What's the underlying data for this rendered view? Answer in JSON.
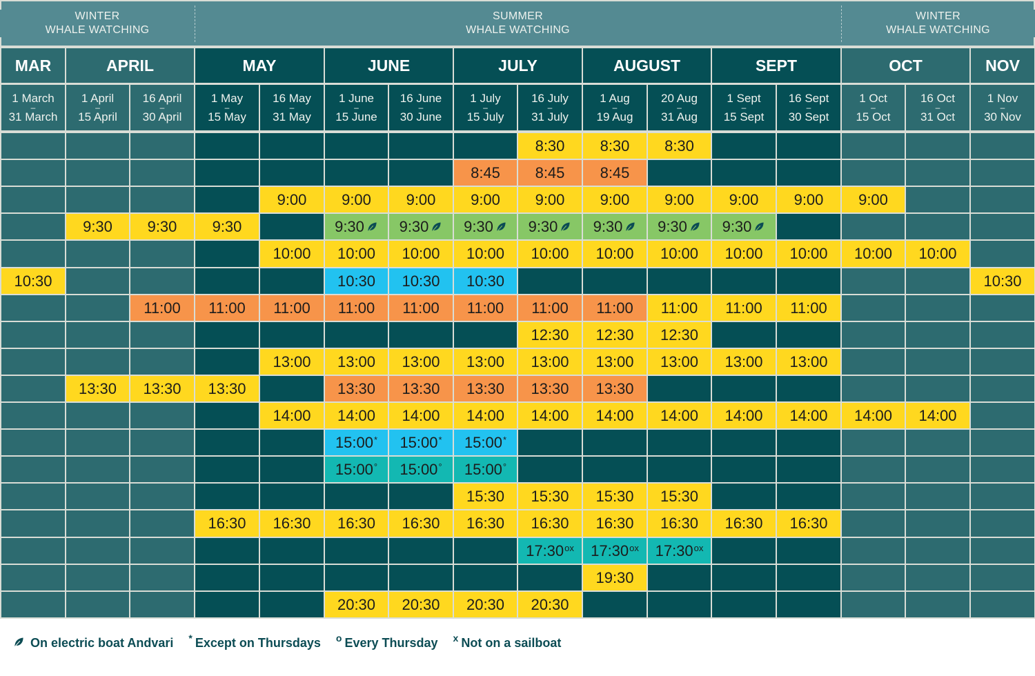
{
  "colors": {
    "season_header": "#548a92",
    "winter_bg": "#2d6b70",
    "summer_bg": "#054f55",
    "yellow": "#ffd81f",
    "orange": "#f7944a",
    "green": "#87c766",
    "blue": "#22c2f0",
    "teal": "#13b8b2",
    "grid_line": "#d9ddd6",
    "legend_text": "#0c4c54",
    "leaf": "#0c4c54"
  },
  "seasons": [
    {
      "line1": "WINTER",
      "line2": "WHALE WATCHING",
      "span": [
        0,
        2
      ]
    },
    {
      "line1": "SUMMER",
      "line2": "WHALE WATCHING",
      "span": [
        3,
        12
      ]
    },
    {
      "line1": "WINTER",
      "line2": "WHALE WATCHING",
      "span": [
        13,
        15
      ]
    }
  ],
  "months": [
    {
      "label": "MAR",
      "span": [
        0,
        0
      ],
      "tone": "light"
    },
    {
      "label": "APRIL",
      "span": [
        1,
        2
      ],
      "tone": "light"
    },
    {
      "label": "MAY",
      "span": [
        3,
        4
      ],
      "tone": "dark"
    },
    {
      "label": "JUNE",
      "span": [
        5,
        6
      ],
      "tone": "dark"
    },
    {
      "label": "JULY",
      "span": [
        7,
        8
      ],
      "tone": "dark"
    },
    {
      "label": "AUGUST",
      "span": [
        9,
        10
      ],
      "tone": "dark"
    },
    {
      "label": "SEPT",
      "span": [
        11,
        12
      ],
      "tone": "dark"
    },
    {
      "label": "OCT",
      "span": [
        13,
        14
      ],
      "tone": "light"
    },
    {
      "label": "NOV",
      "span": [
        15,
        15
      ],
      "tone": "light"
    }
  ],
  "periods": [
    {
      "from": "1 March",
      "to": "31 March",
      "tone": "light"
    },
    {
      "from": "1 April",
      "to": "15 April",
      "tone": "light"
    },
    {
      "from": "16 April",
      "to": "30 April",
      "tone": "light"
    },
    {
      "from": "1 May",
      "to": "15 May",
      "tone": "dark"
    },
    {
      "from": "16 May",
      "to": "31 May",
      "tone": "dark"
    },
    {
      "from": "1 June",
      "to": "15 June",
      "tone": "dark"
    },
    {
      "from": "16 June",
      "to": "30 June",
      "tone": "dark"
    },
    {
      "from": "1 July",
      "to": "15 July",
      "tone": "dark"
    },
    {
      "from": "16 July",
      "to": "31 July",
      "tone": "dark"
    },
    {
      "from": "1 Aug",
      "to": "19 Aug",
      "tone": "dark"
    },
    {
      "from": "20 Aug",
      "to": "31 Aug",
      "tone": "dark"
    },
    {
      "from": "1 Sept",
      "to": "15 Sept",
      "tone": "dark"
    },
    {
      "from": "16 Sept",
      "to": "30 Sept",
      "tone": "dark"
    },
    {
      "from": "1 Oct",
      "to": "15 Oct",
      "tone": "light"
    },
    {
      "from": "16 Oct",
      "to": "31 Oct",
      "tone": "light"
    },
    {
      "from": "1 Nov",
      "to": "30 Nov",
      "tone": "light"
    }
  ],
  "range_dash": "–",
  "schedule": [
    {
      "time": "8:30",
      "mark": "",
      "cells": [
        {
          "cols": [
            8,
            10
          ],
          "color": "yellow"
        }
      ]
    },
    {
      "time": "8:45",
      "mark": "",
      "cells": [
        {
          "cols": [
            7,
            9
          ],
          "color": "orange"
        }
      ]
    },
    {
      "time": "9:00",
      "mark": "",
      "cells": [
        {
          "cols": [
            4,
            13
          ],
          "color": "yellow"
        }
      ]
    },
    {
      "time": "9:30",
      "mark": "",
      "cells": [
        {
          "cols": [
            1,
            3
          ],
          "color": "yellow"
        },
        {
          "cols": [
            5,
            11
          ],
          "color": "green",
          "leaf": true
        }
      ]
    },
    {
      "time": "10:00",
      "mark": "",
      "cells": [
        {
          "cols": [
            4,
            14
          ],
          "color": "yellow"
        }
      ]
    },
    {
      "time": "10:30",
      "mark": "",
      "cells": [
        {
          "cols": [
            0,
            0
          ],
          "color": "yellow"
        },
        {
          "cols": [
            5,
            7
          ],
          "color": "blue"
        },
        {
          "cols": [
            15,
            15
          ],
          "color": "yellow"
        }
      ]
    },
    {
      "time": "11:00",
      "mark": "",
      "cells": [
        {
          "cols": [
            2,
            9
          ],
          "color": "orange"
        },
        {
          "cols": [
            10,
            12
          ],
          "color": "yellow"
        }
      ]
    },
    {
      "time": "12:30",
      "mark": "",
      "cells": [
        {
          "cols": [
            8,
            10
          ],
          "color": "yellow"
        }
      ]
    },
    {
      "time": "13:00",
      "mark": "",
      "cells": [
        {
          "cols": [
            4,
            12
          ],
          "color": "yellow"
        }
      ]
    },
    {
      "time": "13:30",
      "mark": "",
      "cells": [
        {
          "cols": [
            1,
            3
          ],
          "color": "yellow"
        },
        {
          "cols": [
            5,
            9
          ],
          "color": "orange"
        }
      ]
    },
    {
      "time": "14:00",
      "mark": "",
      "cells": [
        {
          "cols": [
            4,
            14
          ],
          "color": "yellow"
        }
      ]
    },
    {
      "time": "15:00",
      "mark": "*",
      "cells": [
        {
          "cols": [
            5,
            7
          ],
          "color": "blue"
        }
      ]
    },
    {
      "time": "15:00",
      "mark": "°",
      "cells": [
        {
          "cols": [
            5,
            7
          ],
          "color": "teal"
        }
      ]
    },
    {
      "time": "15:30",
      "mark": "",
      "cells": [
        {
          "cols": [
            7,
            10
          ],
          "color": "yellow"
        }
      ]
    },
    {
      "time": "16:30",
      "mark": "",
      "cells": [
        {
          "cols": [
            3,
            12
          ],
          "color": "yellow"
        }
      ]
    },
    {
      "time": "17:30",
      "mark": "ox",
      "cells": [
        {
          "cols": [
            8,
            10
          ],
          "color": "teal"
        }
      ]
    },
    {
      "time": "19:30",
      "mark": "",
      "cells": [
        {
          "cols": [
            9,
            9
          ],
          "color": "yellow"
        }
      ]
    },
    {
      "time": "20:30",
      "mark": "",
      "cells": [
        {
          "cols": [
            5,
            8
          ],
          "color": "yellow"
        }
      ]
    }
  ],
  "legend": [
    {
      "icon": "leaf-icon",
      "mark": "",
      "label": "On electric boat Andvari"
    },
    {
      "icon": "",
      "mark": "*",
      "label": "Except on Thursdays"
    },
    {
      "icon": "",
      "mark": "o",
      "label": "Every Thursday"
    },
    {
      "icon": "",
      "mark": "x",
      "label": "Not on a sailboat"
    }
  ]
}
